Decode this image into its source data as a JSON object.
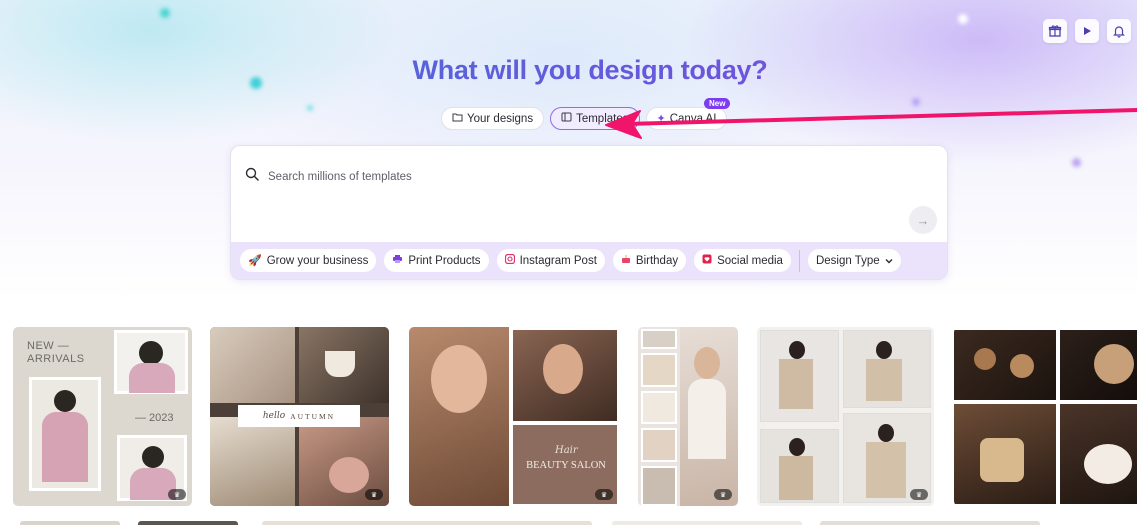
{
  "header": {
    "title": "What will you design today?",
    "icons": [
      "gift-icon",
      "play-icon",
      "bell-icon"
    ]
  },
  "tabs": [
    {
      "label": "Your designs",
      "icon": "folder-icon"
    },
    {
      "label": "Templates",
      "icon": "template-icon",
      "active": true
    },
    {
      "label": "Canva AI",
      "icon": "sparkle-icon",
      "badge": "New"
    }
  ],
  "search": {
    "placeholder": "Search millions of templates",
    "submit_icon": "arrow-right-icon"
  },
  "chips": [
    {
      "label": "Grow your business",
      "icon": "rocket-icon",
      "color": "#5a4fd6"
    },
    {
      "label": "Print Products",
      "icon": "printer-icon",
      "color": "#7b3fe4"
    },
    {
      "label": "Instagram Post",
      "icon": "instagram-icon",
      "color": "#e1306c"
    },
    {
      "label": "Birthday",
      "icon": "cake-icon",
      "color": "#e9456b"
    },
    {
      "label": "Social media",
      "icon": "heart-icon",
      "color": "#e0234e"
    }
  ],
  "design_type": {
    "label": "Design Type",
    "icon": "chevron-down-icon"
  },
  "templates": [
    {
      "name": "new-arrivals",
      "texts": {
        "top": "NEW —",
        "top2": "ARRIVALS",
        "year": "— 2023"
      }
    },
    {
      "name": "autumn-hello",
      "texts": {
        "script": "hello",
        "word": "AUTUMN"
      }
    },
    {
      "name": "beauty-salon",
      "texts": {
        "script": "Hair",
        "word": "BEAUTY SALON"
      }
    },
    {
      "name": "fashion-stories"
    },
    {
      "name": "fashion-collage"
    },
    {
      "name": "coffee-collage"
    }
  ],
  "annotation": {
    "color": "#f0146b"
  }
}
